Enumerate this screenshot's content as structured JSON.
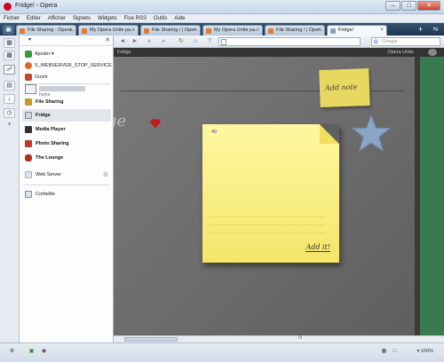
{
  "window": {
    "title": "Fridge! - Opera",
    "min_label": "–",
    "max_label": "□",
    "close_label": "✕"
  },
  "menubar": [
    "Fichier",
    "Editer",
    "Afficher",
    "Signets",
    "Widgets",
    "Flux RSS",
    "Outils",
    "Aide"
  ],
  "tabs": [
    {
      "label": "File Sharing - Opera...",
      "active": false
    },
    {
      "label": "My Opera Unite pa...",
      "active": false
    },
    {
      "label": "File Sharing / | Oper...",
      "active": false
    },
    {
      "label": "My Opera Unite pa...",
      "active": false
    },
    {
      "label": "File Sharing / | Oper...",
      "active": false
    },
    {
      "label": "Fridge!",
      "active": true
    }
  ],
  "tabbar": {
    "add_label": "+",
    "menu_label": "⇆"
  },
  "sidebar": {
    "menu_toggle": "▾",
    "close_label": "✕",
    "actions": [
      {
        "label": "Ajouter ▾",
        "icon": "add-icon"
      },
      {
        "label": "S_WEBSERVER_STOP_SERVICE",
        "icon": "stop-icon"
      },
      {
        "label": "Ouvrir",
        "icon": "open-icon"
      }
    ],
    "home_label": "home",
    "services": [
      {
        "label": "File Sharing",
        "icon": "folder-icon",
        "color": "#c79a2c"
      },
      {
        "label": "Fridge",
        "icon": "fridge-icon",
        "color": "#cfd6df"
      },
      {
        "label": "Media Player",
        "icon": "media-icon",
        "color": "#333333"
      },
      {
        "label": "Photo Sharing",
        "icon": "photo-icon",
        "color": "#c0392b"
      },
      {
        "label": "The Lounge",
        "icon": "lounge-icon",
        "color": "#b03020"
      }
    ],
    "web_server": {
      "label": "Web Server",
      "gear": "⚙"
    },
    "trash": {
      "label": "Corbeille"
    },
    "selected": "Fridge"
  },
  "navbar": {
    "back": "◄",
    "forward": "►",
    "rewind": "«",
    "fastforward": "»",
    "reload": "↻",
    "home": "⌂",
    "wand": "?",
    "address_value": "",
    "search_placeholder": "Google",
    "search_engine": "G"
  },
  "page": {
    "unite_left": "Fridge",
    "unite_brand": "Opera Unite",
    "fridge_text": "ge",
    "add_note_label": "Add note",
    "note_number": "40",
    "note_add_label": "Add it!",
    "close_mark": "✕"
  },
  "status": {
    "zoom": "▾ 100%",
    "grip": "III"
  },
  "colors": {
    "accent": "#1e3550",
    "fridge": "#6b6b6b",
    "note": "#f7ea7a",
    "star": "#8aa5c6",
    "heart": "#c21a1a"
  }
}
